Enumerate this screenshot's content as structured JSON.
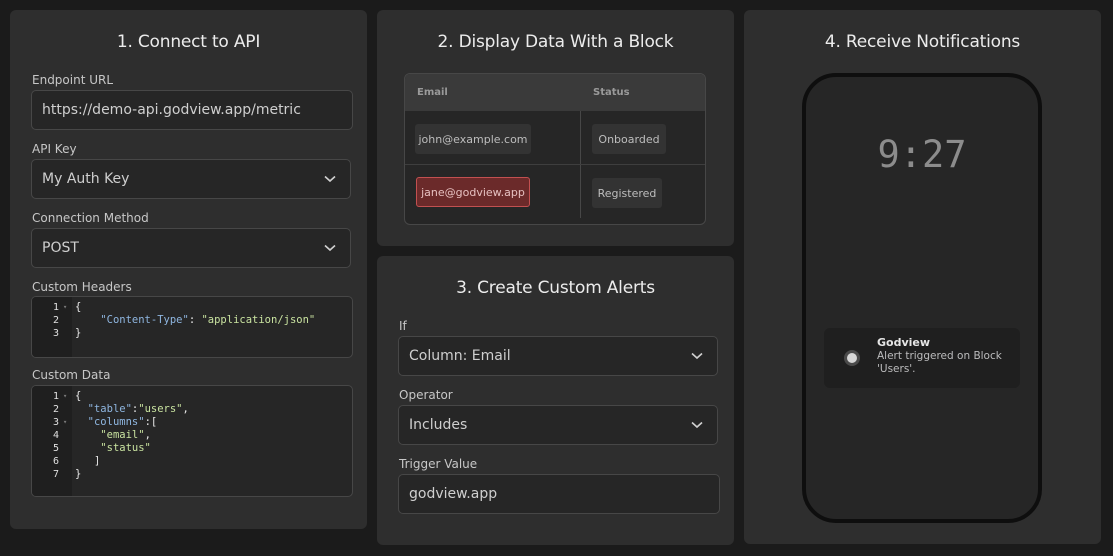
{
  "panel1": {
    "title": "1. Connect to API",
    "endpoint": {
      "label": "Endpoint URL",
      "value": "https://demo-api.godview.app/metric"
    },
    "api_key": {
      "label": "API Key",
      "value": "My Auth Key"
    },
    "method": {
      "label": "Connection Method",
      "value": "POST"
    },
    "headers": {
      "label": "Custom Headers",
      "lines": [
        {
          "num": "1",
          "fold": true,
          "text": "{"
        },
        {
          "num": "2",
          "fold": false,
          "key": "\"Content-Type\"",
          "sep": ": ",
          "str": "\"application/json\"",
          "indent": "    "
        },
        {
          "num": "3",
          "fold": false,
          "text": "}"
        }
      ]
    },
    "data": {
      "label": "Custom Data",
      "lines": [
        {
          "num": "1",
          "fold": true,
          "text": "{"
        },
        {
          "num": "2",
          "fold": false,
          "indent": "  ",
          "key": "\"table\"",
          "sep": ":",
          "str": "\"users\"",
          "tail": ","
        },
        {
          "num": "3",
          "fold": true,
          "indent": "  ",
          "key": "\"columns\"",
          "sep": ":["
        },
        {
          "num": "4",
          "fold": false,
          "indent": "    ",
          "str": "\"email\"",
          "tail": ","
        },
        {
          "num": "5",
          "fold": false,
          "indent": "    ",
          "str": "\"status\""
        },
        {
          "num": "6",
          "fold": false,
          "text": "   ]"
        },
        {
          "num": "7",
          "fold": false,
          "text": "}"
        }
      ]
    }
  },
  "panel2": {
    "title": "2. Display Data With a Block",
    "columns": [
      "Email",
      "Status"
    ],
    "rows": [
      {
        "email": "john@example.com",
        "status": "Onboarded"
      },
      {
        "email": "jane@godview.app",
        "status": "Registered"
      }
    ]
  },
  "panel3": {
    "title": "3. Create Custom Alerts",
    "if": {
      "label": "If",
      "value": "Column: Email"
    },
    "operator": {
      "label": "Operator",
      "value": "Includes"
    },
    "trigger": {
      "label": "Trigger Value",
      "value": "godview.app"
    }
  },
  "panel4": {
    "title": "4. Receive Notifications",
    "clock": "9:27",
    "notification": {
      "app": "Godview",
      "message": "Alert triggered on Block 'Users'."
    }
  },
  "icons": {
    "chevron": "chevron-down-icon",
    "fold": "fold-arrow-icon",
    "app": "app-dot-icon"
  },
  "colors": {
    "highlight_bg": "#6b2a2a",
    "highlight_border": "#c25050"
  }
}
